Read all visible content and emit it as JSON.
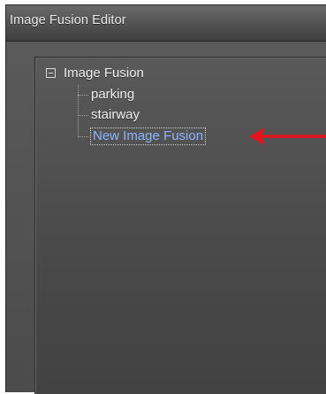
{
  "window": {
    "title": "Image Fusion Editor"
  },
  "tree": {
    "root": {
      "label": "Image Fusion",
      "expanded": true
    },
    "children": [
      {
        "label": "parking",
        "selected": false
      },
      {
        "label": "stairway",
        "selected": false
      },
      {
        "label": "New Image Fusion",
        "selected": true
      }
    ]
  },
  "annotation": {
    "arrow_color": "#e3141b",
    "arrow_direction": "left"
  }
}
